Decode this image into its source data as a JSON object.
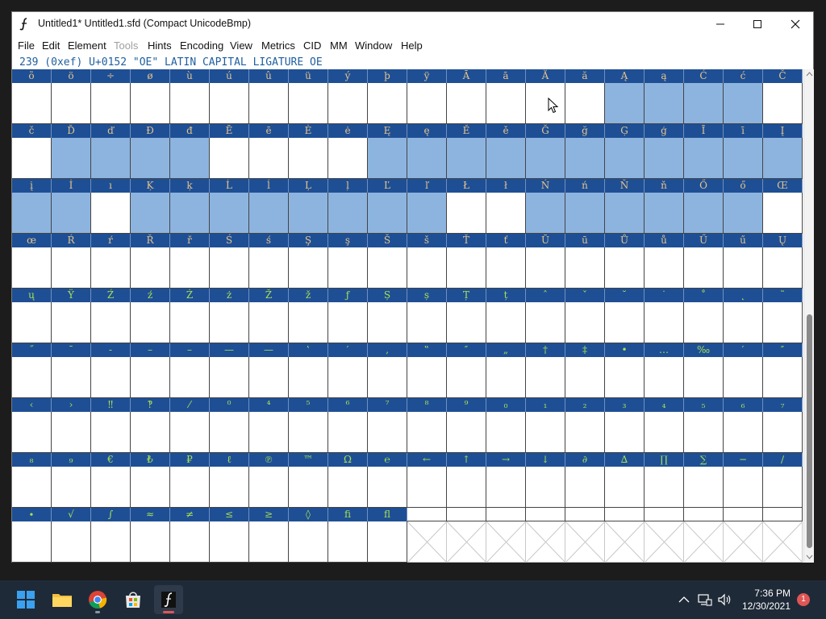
{
  "window": {
    "title": "Untitled1*  Untitled1.sfd (Compact UnicodeBmp)"
  },
  "menu": [
    {
      "label": "File",
      "enabled": true
    },
    {
      "label": "Edit",
      "enabled": true
    },
    {
      "label": "Element",
      "enabled": true
    },
    {
      "label": "Tools",
      "enabled": false
    },
    {
      "label": "Hints",
      "enabled": true
    },
    {
      "label": "Encoding",
      "enabled": true
    },
    {
      "label": "View",
      "enabled": true
    },
    {
      "label": "Metrics",
      "enabled": true
    },
    {
      "label": "CID",
      "enabled": true
    },
    {
      "label": "MM",
      "enabled": true
    },
    {
      "label": "Window",
      "enabled": true
    },
    {
      "label": "Help",
      "enabled": true
    }
  ],
  "info_line": "239 (0xef) U+0152 \"OE\" LATIN CAPITAL LIGATURE OE",
  "glyph_rows": [
    {
      "glyphs": [
        "õ",
        "ö",
        "÷",
        "ø",
        "ù",
        "ú",
        "û",
        "ü",
        "ý",
        "þ",
        "ÿ",
        "Ā",
        "ā",
        "Ă",
        "ă",
        "Ą",
        "ą",
        "Ć",
        "ć",
        "Č"
      ],
      "selected": [
        false,
        false,
        false,
        false,
        false,
        false,
        false,
        false,
        false,
        false,
        false,
        false,
        false,
        false,
        false,
        true,
        true,
        true,
        true,
        false
      ]
    },
    {
      "glyphs": [
        "č",
        "Ď",
        "ď",
        "Đ",
        "đ",
        "Ē",
        "ē",
        "Ė",
        "ė",
        "Ę",
        "ę",
        "Ě",
        "ě",
        "Ğ",
        "ğ",
        "Ģ",
        "ģ",
        "Ī",
        "ī",
        "Į"
      ],
      "selected": [
        false,
        true,
        true,
        true,
        true,
        false,
        false,
        false,
        false,
        true,
        true,
        true,
        true,
        true,
        true,
        true,
        true,
        true,
        true,
        true
      ]
    },
    {
      "glyphs": [
        "į",
        "İ",
        "ı",
        "Ķ",
        "ķ",
        "Ĺ",
        "ĺ",
        "Ļ",
        "ļ",
        "Ľ",
        "ľ",
        "Ł",
        "ł",
        "Ń",
        "ń",
        "Ň",
        "ň",
        "Ő",
        "ő",
        "Œ"
      ],
      "selected": [
        true,
        true,
        false,
        true,
        true,
        true,
        true,
        true,
        true,
        true,
        true,
        false,
        false,
        true,
        true,
        true,
        true,
        true,
        true,
        false
      ]
    },
    {
      "glyphs": [
        "œ",
        "Ŕ",
        "ŕ",
        "Ř",
        "ř",
        "Ś",
        "ś",
        "Ş",
        "ş",
        "Š",
        "š",
        "Ť",
        "ť",
        "Ū",
        "ū",
        "Ů",
        "ů",
        "Ű",
        "ű",
        "Ų"
      ],
      "selected": [
        false,
        false,
        false,
        false,
        false,
        false,
        false,
        false,
        false,
        false,
        false,
        false,
        false,
        false,
        false,
        false,
        false,
        false,
        false,
        false
      ]
    },
    {
      "glyphs": [
        "ų",
        "Ÿ",
        "Ź",
        "ź",
        "Ż",
        "ż",
        "Ž",
        "ž",
        "ƒ",
        "Ș",
        "ș",
        "Ț",
        "ț",
        "ˆ",
        "ˇ",
        "˘",
        "˙",
        "˚",
        "˛",
        "˜"
      ],
      "selected": [
        false,
        false,
        false,
        false,
        false,
        false,
        false,
        false,
        false,
        false,
        false,
        false,
        false,
        false,
        false,
        false,
        false,
        false,
        false,
        false
      ]
    },
    {
      "glyphs": [
        "˝",
        "¯",
        "‐",
        "–",
        "–",
        "—",
        "—",
        "‛",
        "′",
        "‚",
        "‟",
        "″",
        "„",
        "†",
        "‡",
        "•",
        "…",
        "‰",
        "′",
        "″"
      ],
      "selected": [
        false,
        false,
        false,
        false,
        false,
        false,
        false,
        false,
        false,
        false,
        false,
        false,
        false,
        false,
        false,
        false,
        false,
        false,
        false,
        false
      ]
    },
    {
      "glyphs": [
        "‹",
        "›",
        "‼",
        "‽",
        "⁄",
        "⁰",
        "⁴",
        "⁵",
        "⁶",
        "⁷",
        "⁸",
        "⁹",
        "₀",
        "₁",
        "₂",
        "₃",
        "₄",
        "₅",
        "₆",
        "₇"
      ],
      "selected": [
        false,
        false,
        false,
        false,
        false,
        false,
        false,
        false,
        false,
        false,
        false,
        false,
        false,
        false,
        false,
        false,
        false,
        false,
        false,
        false
      ]
    },
    {
      "glyphs": [
        "₈",
        "₉",
        "€",
        "₺",
        "₽",
        "ℓ",
        "℗",
        "™",
        "Ω",
        "℮",
        "←",
        "↑",
        "→",
        "↓",
        "∂",
        "∆",
        "∏",
        "∑",
        "−",
        "∕"
      ],
      "selected": [
        false,
        false,
        false,
        false,
        false,
        false,
        false,
        false,
        false,
        false,
        false,
        false,
        false,
        false,
        false,
        false,
        false,
        false,
        false,
        false
      ]
    },
    {
      "glyphs": [
        "∙",
        "√",
        "∫",
        "≈",
        "≠",
        "≤",
        "≥",
        "◊",
        "ﬁ",
        "ﬂ"
      ],
      "selected": [
        false,
        false,
        false,
        false,
        false,
        false,
        false,
        false,
        false,
        false
      ]
    }
  ],
  "taskbar": {
    "apps": [
      "start-button",
      "file-explorer",
      "chrome",
      "microsoft-store",
      "fontforge"
    ],
    "time": "7:36 PM",
    "date": "12/30/2021",
    "notification_count": "1"
  }
}
